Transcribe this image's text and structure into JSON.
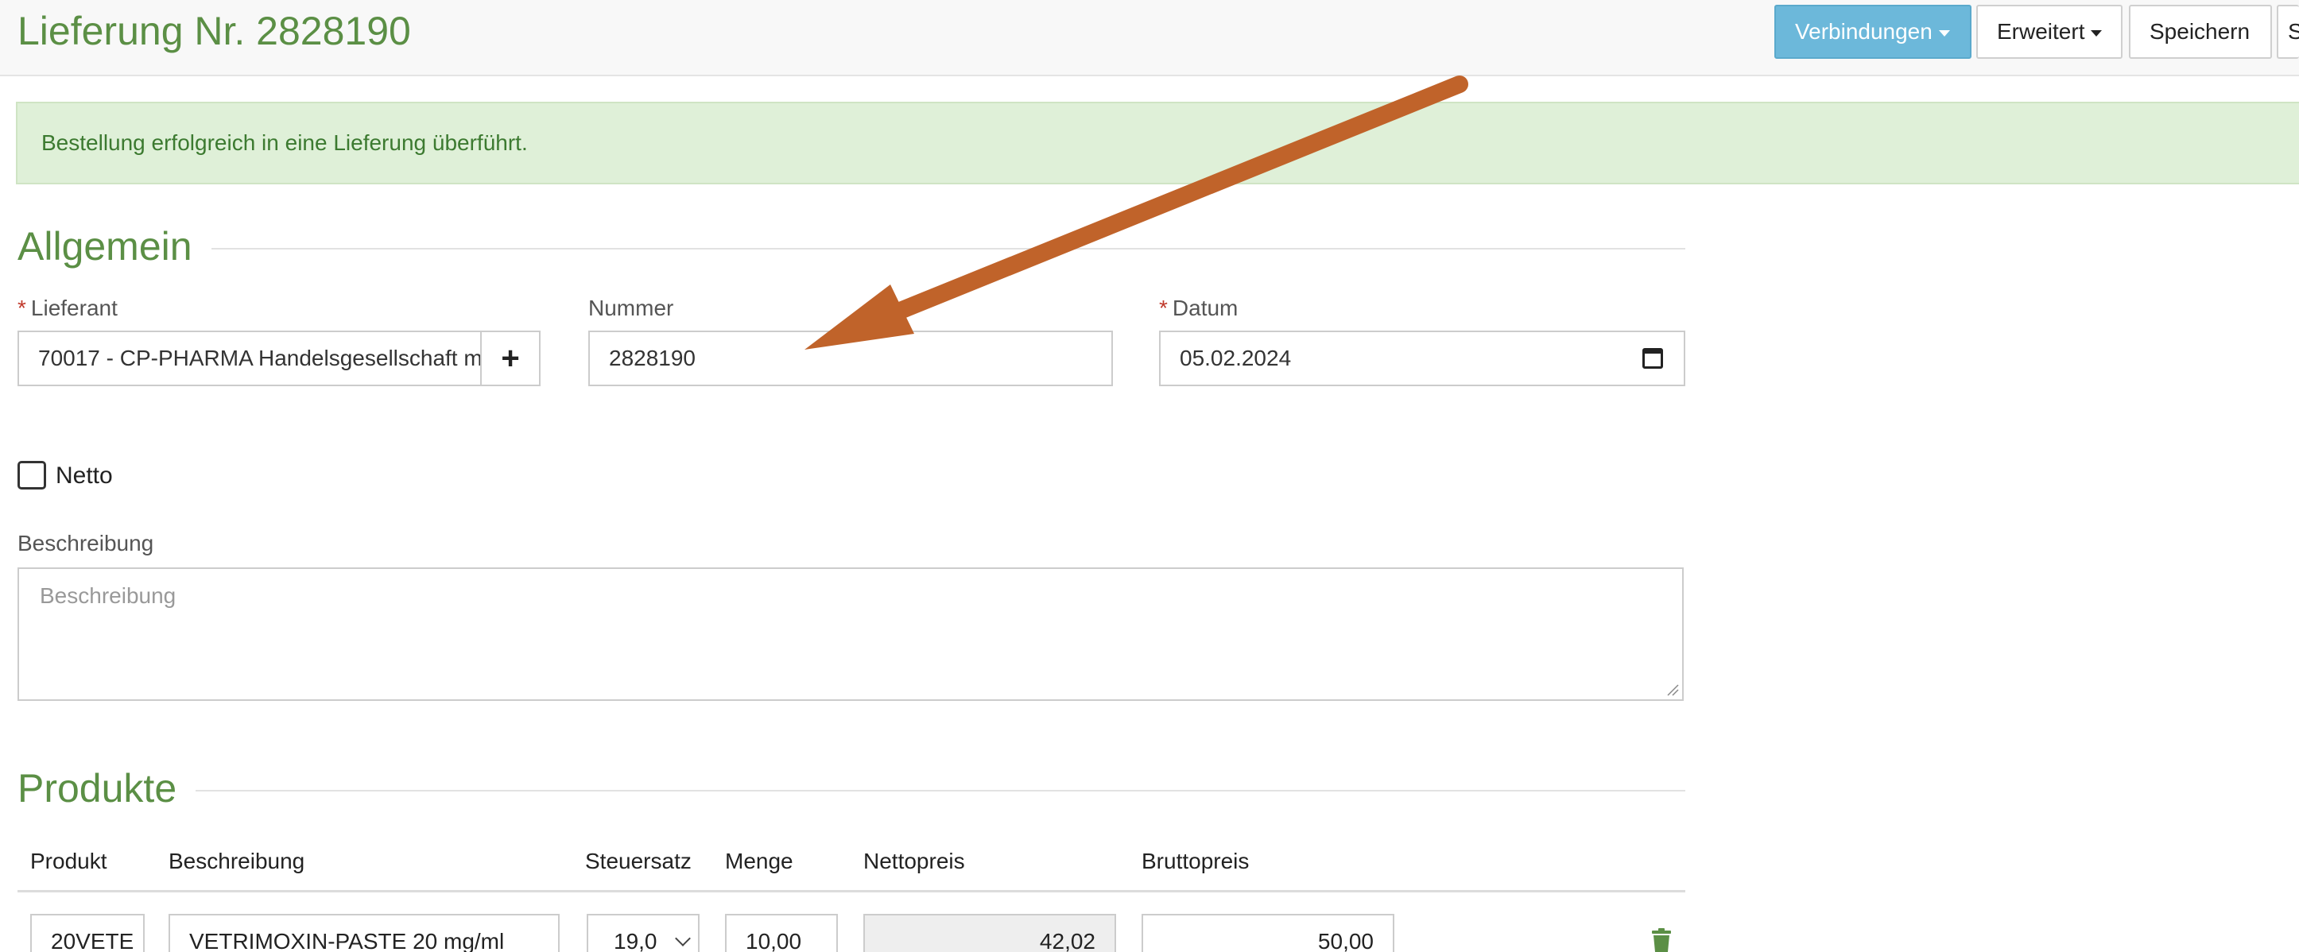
{
  "header": {
    "title": "Lieferung Nr. 2828190",
    "buttons": {
      "verbindungen": "Verbindungen",
      "erweitert": "Erweitert",
      "speichern": "Speichern",
      "cut_off": "S"
    }
  },
  "alert": {
    "message": "Bestellung erfolgreich in eine Lieferung überführt."
  },
  "allgemein": {
    "section_title": "Allgemein",
    "required_marker": "*",
    "lieferant": {
      "label": "Lieferant",
      "value": "70017 - CP-PHARMA Handelsgesellschaft m",
      "add_symbol": "+"
    },
    "nummer": {
      "label": "Nummer",
      "value": "2828190"
    },
    "datum": {
      "label": "Datum",
      "value": "05.02.2024"
    },
    "netto": {
      "label": "Netto",
      "checked": false
    },
    "beschreibung": {
      "label": "Beschreibung",
      "placeholder": "Beschreibung",
      "value": ""
    }
  },
  "produkte": {
    "section_title": "Produkte",
    "columns": [
      "Produkt",
      "Beschreibung",
      "Steuersatz",
      "Menge",
      "Nettopreis",
      "Bruttopreis"
    ],
    "rows": [
      {
        "produkt": "20VETE",
        "beschreibung": "VETRIMOXIN-PASTE 20 mg/ml",
        "steuersatz": "19,0",
        "menge": "10,00",
        "nettopreis": "42,02",
        "bruttopreis": "50,00"
      }
    ]
  },
  "icons": {
    "add": "plus-icon",
    "calendar": "calendar-icon",
    "delete": "trash-icon",
    "dropdown": "chevron-down-icon",
    "caret": "caret-down-icon"
  },
  "colors": {
    "brand_green": "#5b8f45",
    "alert_bg": "#dff0d8",
    "primary_button": "#6cb8da",
    "annotation_arrow": "#c0632a",
    "required": "#c0392b"
  }
}
